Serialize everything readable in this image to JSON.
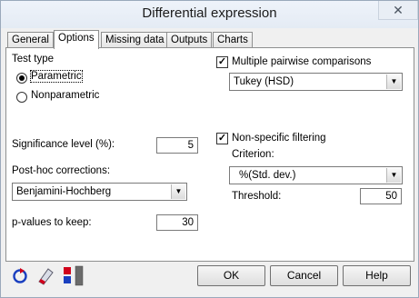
{
  "window": {
    "title": "Differential expression",
    "close_glyph": "✕"
  },
  "tabs": [
    {
      "label": "General"
    },
    {
      "label": "Options"
    },
    {
      "label": "Missing data"
    },
    {
      "label": "Outputs"
    },
    {
      "label": "Charts"
    }
  ],
  "test_type": {
    "label": "Test type",
    "options": [
      {
        "label": "Parametric",
        "selected": true
      },
      {
        "label": "Nonparametric",
        "selected": false
      }
    ]
  },
  "significance": {
    "label": "Significance level (%):",
    "value": "5"
  },
  "posthoc": {
    "label": "Post-hoc corrections:",
    "value": "Benjamini-Hochberg"
  },
  "pvalues": {
    "label": "p-values to keep:",
    "value": "30"
  },
  "multiple_pairwise": {
    "label": "Multiple pairwise comparisons",
    "checked": true,
    "method": "Tukey (HSD)"
  },
  "nonspecific": {
    "label": "Non-specific filtering",
    "checked": true,
    "criterion_label": "Criterion:",
    "criterion_value": "%(Std. dev.)",
    "threshold_label": "Threshold:",
    "threshold_value": "50"
  },
  "buttons": {
    "ok": "OK",
    "cancel": "Cancel",
    "help": "Help"
  },
  "icons": [
    "reset-icon",
    "eraser-icon",
    "layout-toggle-icon"
  ],
  "colors": {
    "accent_red": "#d0021b",
    "accent_blue": "#1a3fbf"
  }
}
